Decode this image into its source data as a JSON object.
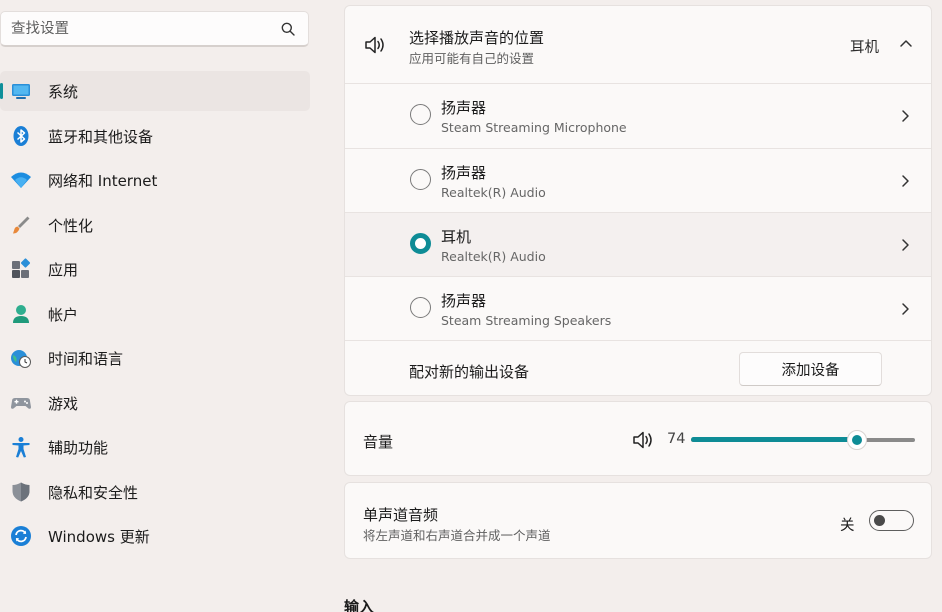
{
  "search": {
    "placeholder": "查找设置"
  },
  "sidebar": {
    "items": [
      {
        "label": "系统",
        "icon": "system-monitor-icon",
        "active": true
      },
      {
        "label": "蓝牙和其他设备",
        "icon": "bluetooth-icon"
      },
      {
        "label": "网络和 Internet",
        "icon": "wifi-icon"
      },
      {
        "label": "个性化",
        "icon": "brush-icon"
      },
      {
        "label": "应用",
        "icon": "apps-icon"
      },
      {
        "label": "帐户",
        "icon": "account-icon"
      },
      {
        "label": "时间和语言",
        "icon": "globe-clock-icon"
      },
      {
        "label": "游戏",
        "icon": "gamepad-icon"
      },
      {
        "label": "辅助功能",
        "icon": "accessibility-icon"
      },
      {
        "label": "隐私和安全性",
        "icon": "shield-icon"
      },
      {
        "label": "Windows 更新",
        "icon": "refresh-icon"
      }
    ]
  },
  "output": {
    "title": "选择播放声音的位置",
    "subtitle": "应用可能有自己的设置",
    "current": "耳机",
    "devices": [
      {
        "name": "扬声器",
        "detail": "Steam Streaming Microphone",
        "selected": false
      },
      {
        "name": "扬声器",
        "detail": "Realtek(R) Audio",
        "selected": false
      },
      {
        "name": "耳机",
        "detail": "Realtek(R) Audio",
        "selected": true
      },
      {
        "name": "扬声器",
        "detail": "Steam Streaming Speakers",
        "selected": false
      }
    ],
    "pair_label": "配对新的输出设备",
    "add_button": "添加设备"
  },
  "volume": {
    "label": "音量",
    "value": "74",
    "percent": 74
  },
  "mono": {
    "title": "单声道音频",
    "subtitle": "将左声道和右声道合并成一个声道",
    "state": "关",
    "on": false
  },
  "input": {
    "heading": "输入"
  },
  "colors": {
    "accent": "#0e8c96",
    "background": "#f3eeec",
    "card": "#fbf9f8"
  }
}
